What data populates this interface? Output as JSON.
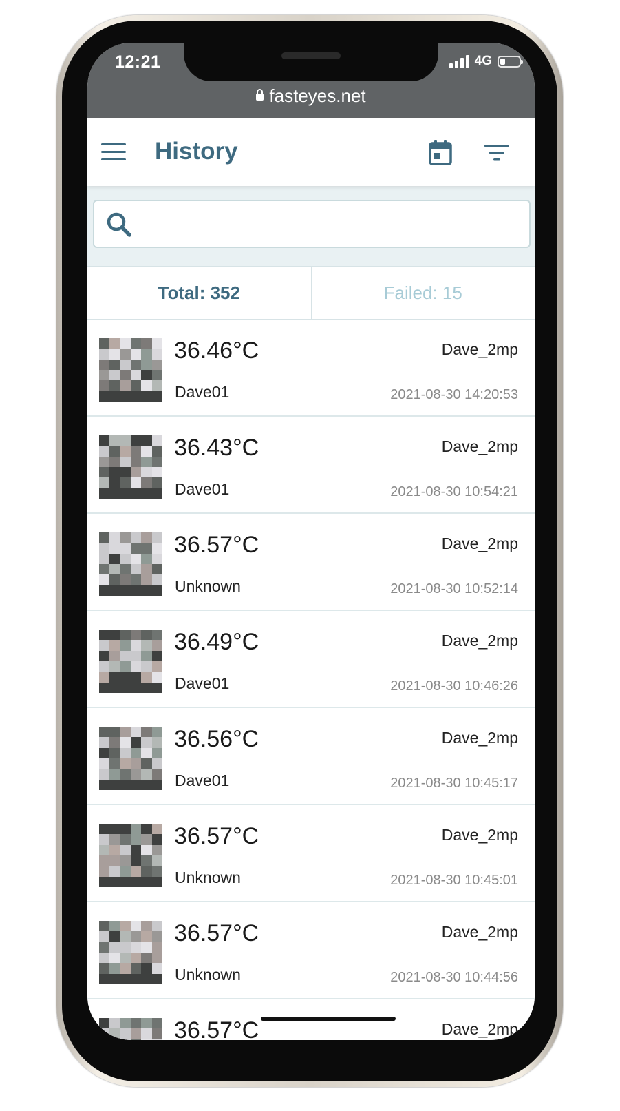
{
  "status_bar": {
    "time": "12:21",
    "network": "4G"
  },
  "browser": {
    "url": "fasteyes.net"
  },
  "header": {
    "title": "History",
    "menu_icon": "menu-icon",
    "calendar_icon": "calendar-icon",
    "filter_icon": "filter-icon"
  },
  "search": {
    "placeholder": "",
    "value": ""
  },
  "tabs": {
    "total": "Total: 352",
    "failed": "Failed: 15"
  },
  "records": [
    {
      "temperature": "36.46°C",
      "person": "Dave01",
      "device": "Dave_2mp",
      "timestamp": "2021-08-30 14:20:53"
    },
    {
      "temperature": "36.43°C",
      "person": "Dave01",
      "device": "Dave_2mp",
      "timestamp": "2021-08-30 10:54:21"
    },
    {
      "temperature": "36.57°C",
      "person": "Unknown",
      "device": "Dave_2mp",
      "timestamp": "2021-08-30 10:52:14"
    },
    {
      "temperature": "36.49°C",
      "person": "Dave01",
      "device": "Dave_2mp",
      "timestamp": "2021-08-30 10:46:26"
    },
    {
      "temperature": "36.56°C",
      "person": "Dave01",
      "device": "Dave_2mp",
      "timestamp": "2021-08-30 10:45:17"
    },
    {
      "temperature": "36.57°C",
      "person": "Unknown",
      "device": "Dave_2mp",
      "timestamp": "2021-08-30 10:45:01"
    },
    {
      "temperature": "36.57°C",
      "person": "Unknown",
      "device": "Dave_2mp",
      "timestamp": "2021-08-30 10:44:56"
    },
    {
      "temperature": "36.57°C",
      "person": "",
      "device": "Dave_2mp",
      "timestamp": ""
    }
  ],
  "colors": {
    "accent": "#3e6a80",
    "failed_text": "#a7cbd6",
    "search_bg": "#e9f1f3",
    "status_bar_bg": "#606365"
  }
}
